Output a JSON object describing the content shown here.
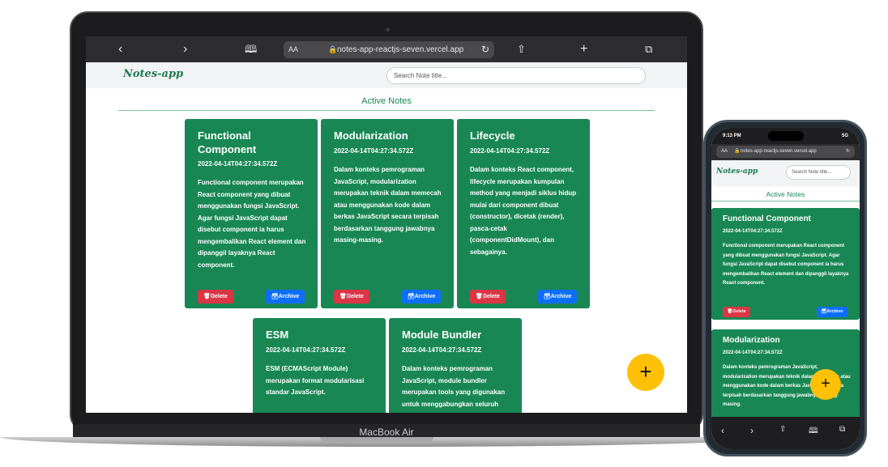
{
  "laptop": {
    "label": "MacBook Air",
    "browser": {
      "text_size_label": "AA",
      "url": "notes-app-reactjs-seven.vercel.app",
      "icons": [
        "chevron-left-icon",
        "chevron-right-icon",
        "book-icon",
        "lock-icon",
        "reload-icon",
        "share-icon",
        "plus-icon",
        "tabs-icon"
      ]
    }
  },
  "app": {
    "logo": "Notes-app",
    "search_placeholder": "Search Note title...",
    "section_title": "Active Notes",
    "delete_label": "Delete",
    "archive_label": "Archive",
    "fab_label": "+",
    "colors": {
      "card": "#198754",
      "delete": "#dc3545",
      "archive": "#0d6efd",
      "fab": "#ffc107",
      "accent_text": "#198754"
    }
  },
  "notes": [
    {
      "title": "Functional Component",
      "date": "2022-04-14T04:27:34.572Z",
      "body": "Functional component merupakan React component yang dibuat menggunakan fungsi JavaScript. Agar fungsi JavaScript dapat disebut component ia harus mengembalikan React element dan dipanggil layaknya React component."
    },
    {
      "title": "Modularization",
      "date": "2022-04-14T04:27:34.572Z",
      "body": "Dalam konteks pemrograman JavaScript, modularization merupakan teknik dalam memecah atau menggunakan kode dalam berkas JavaScript secara terpisah berdasarkan tanggung jawabnya masing-masing."
    },
    {
      "title": "Lifecycle",
      "date": "2022-04-14T04:27:34.572Z",
      "body": "Dalam konteks React component, lifecycle merupakan kumpulan method yang menjadi siklus hidup mulai dari component dibuat (constructor), dicetak (render), pasca-cetak (componentDidMount), dan sebagainya."
    },
    {
      "title": "ESM",
      "date": "2022-04-14T04:27:34.572Z",
      "body": "ESM (ECMAScript Module) merupakan format modularisasi standar JavaScript."
    },
    {
      "title": "Module Bundler",
      "date": "2022-04-14T04:27:34.572Z",
      "body": "Dalam konteks pemrograman JavaScript, module bundler merupakan tools yang digunakan untuk menggabungkan seluruh modul"
    }
  ],
  "phone": {
    "status_time": "9:13 PM",
    "status_network": "5G",
    "url": "notes-app-reactjs-seven.vercel.app",
    "text_size_label": "AA",
    "icons": [
      "chevron-left-icon",
      "chevron-right-icon",
      "share-icon",
      "book-icon",
      "tabs-icon"
    ]
  }
}
